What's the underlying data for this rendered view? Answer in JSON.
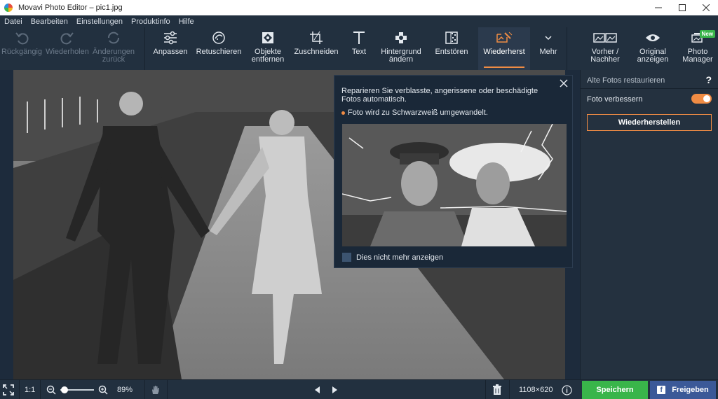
{
  "window": {
    "title": "Movavi Photo Editor – pic1.jpg"
  },
  "menu": [
    "Datei",
    "Bearbeiten",
    "Einstellungen",
    "Produktinfo",
    "Hilfe"
  ],
  "toolbar": {
    "undo": "Rückgängig",
    "redo": "Wiederholen",
    "revert": "Änderungen\nzurück",
    "adjust": "Anpassen",
    "retouch": "Retuschieren",
    "objects": "Objekte\nentfernen",
    "crop": "Zuschneiden",
    "text": "Text",
    "background": "Hintergrund\nändern",
    "denoise": "Entstören",
    "restore": "Wiederherst",
    "more": "Mehr",
    "before_after": "Vorher /\nNachher",
    "original": "Original\nanzeigen",
    "photo_manager": "Photo\nManager",
    "new_badge": "New"
  },
  "popup": {
    "description": "Reparieren Sie verblasste, angerissene oder beschädigte Fotos automatisch.",
    "note": "Foto wird zu Schwarzweiß umgewandelt.",
    "dont_show": "Dies nicht mehr anzeigen"
  },
  "panel": {
    "header": "Alte Fotos restaurieren",
    "help": "?",
    "enhance_label": "Foto verbessern",
    "enhance_on": true,
    "restore_button": "Wiederherstellen"
  },
  "bottom": {
    "ratio": "1:1",
    "zoom": "89%",
    "zoom_fraction": 0.12,
    "dimensions": "1108×620",
    "save": "Speichern",
    "share": "Freigeben"
  },
  "colors": {
    "accent": "#f08c44",
    "save": "#39b54a",
    "share": "#3b5998"
  }
}
